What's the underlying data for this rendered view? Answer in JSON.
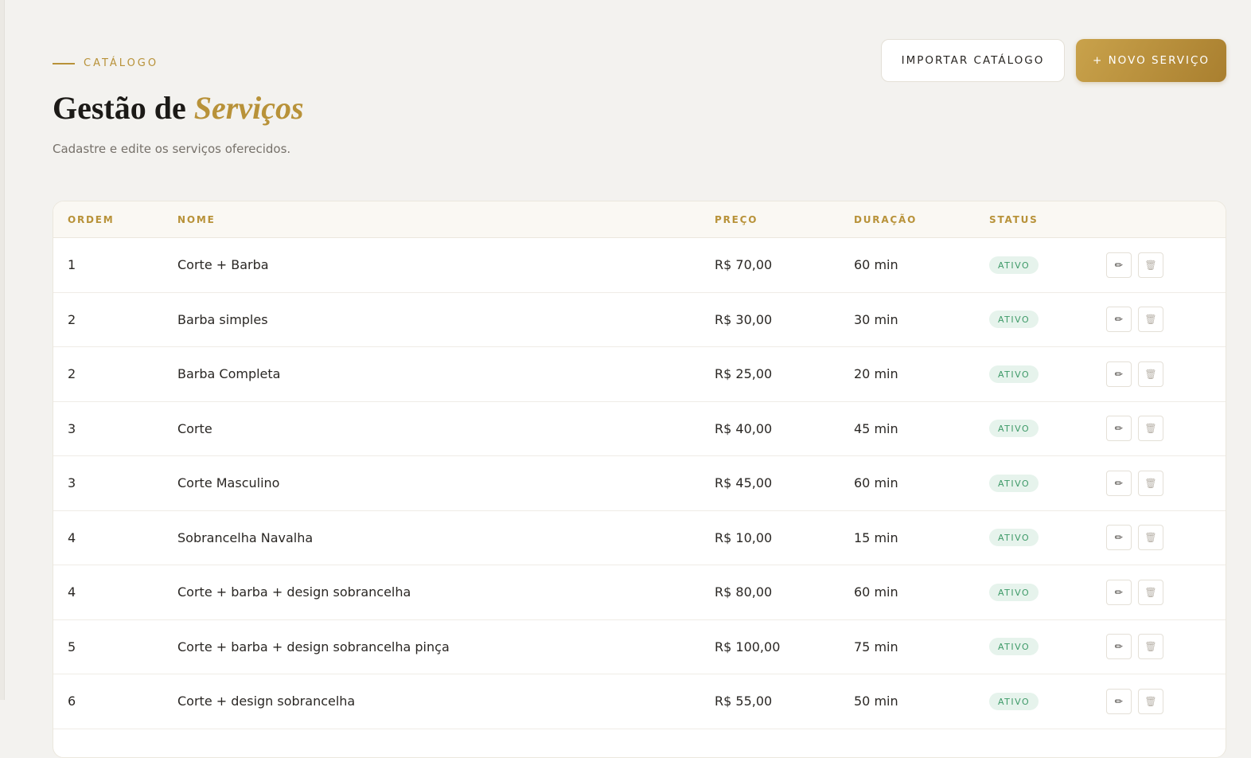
{
  "header": {
    "eyebrow": "CATÁLOGO",
    "title_main": "Gestão de ",
    "title_accent": "Serviços",
    "subtitle": "Cadastre e edite os serviços oferecidos.",
    "import_button": "IMPORTAR CATÁLOGO",
    "new_button": "+ NOVO SERVIÇO"
  },
  "table": {
    "columns": [
      "ORDEM",
      "NOME",
      "PREÇO",
      "DURAÇÃO",
      "STATUS"
    ],
    "rows": [
      {
        "order": "1",
        "name": "Corte + Barba",
        "price": "R$ 70,00",
        "duration": "60 min",
        "status": "ATIVO"
      },
      {
        "order": "2",
        "name": "Barba simples",
        "price": "R$ 30,00",
        "duration": "30 min",
        "status": "ATIVO"
      },
      {
        "order": "2",
        "name": "Barba Completa",
        "price": "R$ 25,00",
        "duration": "20 min",
        "status": "ATIVO"
      },
      {
        "order": "3",
        "name": "Corte",
        "price": "R$ 40,00",
        "duration": "45 min",
        "status": "ATIVO"
      },
      {
        "order": "3",
        "name": "Corte Masculino",
        "price": "R$ 45,00",
        "duration": "60 min",
        "status": "ATIVO"
      },
      {
        "order": "4",
        "name": "Sobrancelha Navalha",
        "price": "R$ 10,00",
        "duration": "15 min",
        "status": "ATIVO"
      },
      {
        "order": "4",
        "name": "Corte + barba + design sobrancelha",
        "price": "R$ 80,00",
        "duration": "60 min",
        "status": "ATIVO"
      },
      {
        "order": "5",
        "name": "Corte + barba + design sobrancelha pinça",
        "price": "R$ 100,00",
        "duration": "75 min",
        "status": "ATIVO"
      },
      {
        "order": "6",
        "name": "Corte + design sobrancelha",
        "price": "R$ 55,00",
        "duration": "50 min",
        "status": "ATIVO"
      }
    ],
    "edit_icon": "pencil-icon",
    "delete_icon": "trash-icon"
  },
  "colors": {
    "accent": "#b89239",
    "status_bg": "#e6f3ec",
    "status_text": "#3e9a68"
  }
}
